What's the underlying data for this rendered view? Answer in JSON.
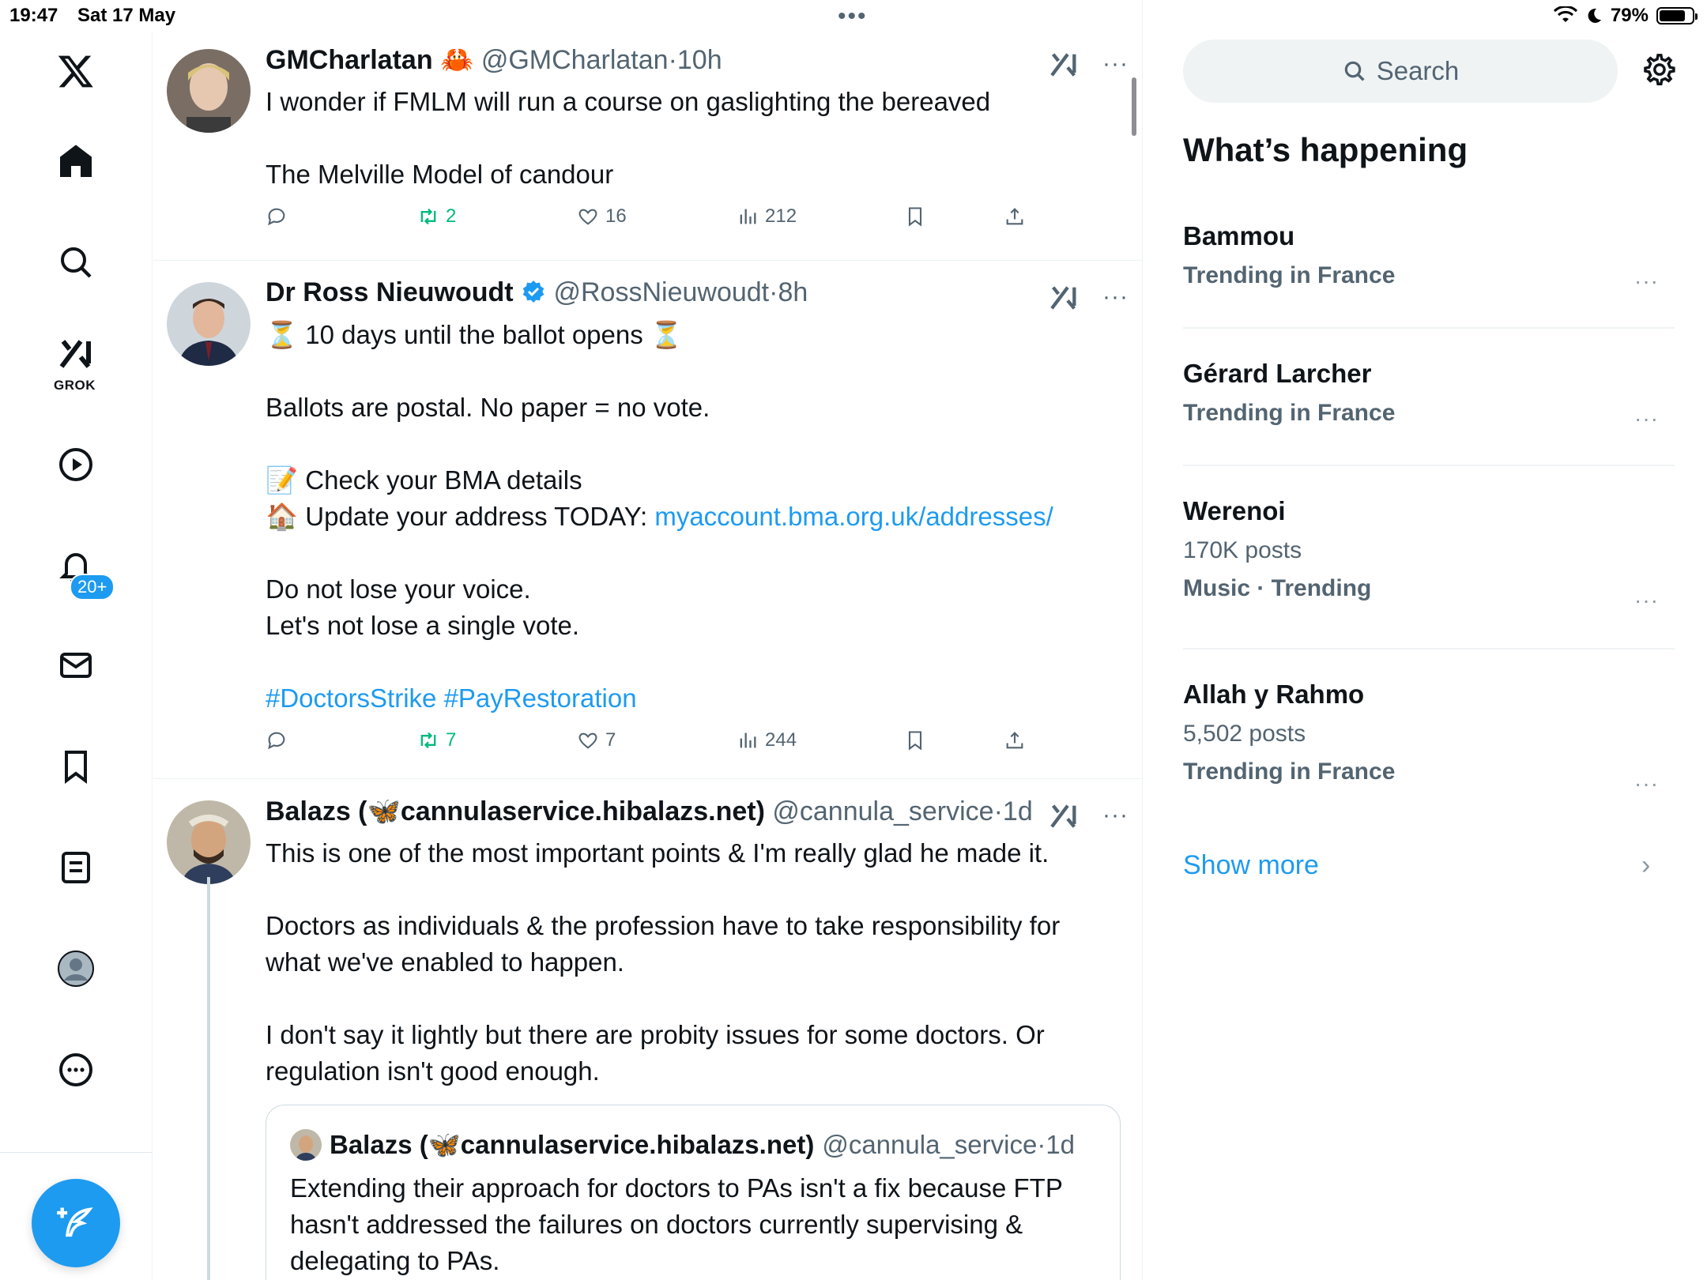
{
  "status_bar": {
    "time": "19:47",
    "date": "Sat 17 May",
    "battery": "79%",
    "battery_fraction": 0.79
  },
  "nav": {
    "grok_label": "GROK",
    "notifications_badge": "20+"
  },
  "tweets": [
    {
      "name": "GMCharlatan",
      "name_emoji": "🦀",
      "handle": "@GMCharlatan",
      "time": "10h",
      "lines": [
        "I wonder if FMLM will run a course on gaslighting the bereaved",
        "",
        "The Melville Model of candour"
      ],
      "retweets": "2",
      "likes": "16",
      "views": "212"
    },
    {
      "name": "Dr Ross Nieuwoudt",
      "handle": "@RossNieuwoudt",
      "time": "8h",
      "line1": "⏳ 10 days until the ballot opens ⏳",
      "line2": "Ballots are postal. No paper = no vote.",
      "line3": "📝 Check your BMA details",
      "line4_prefix": "🏠 Update your address TODAY: ",
      "line4_link": "myaccount.bma.org.uk/addresses/",
      "line5": "Do not lose your voice.",
      "line6": "Let's not lose a single vote.",
      "hashtags": "#DoctorsStrike #PayRestoration",
      "retweets": "7",
      "likes": "7",
      "views": "244"
    },
    {
      "name": "Balazs (🦋cannulaservice.hibalazs.net)",
      "handle": "@cannula_service",
      "time": "1d",
      "line1": "This is one of the most important points & I'm really glad he made it.",
      "line2": "Doctors as individuals & the profession have to take responsibility for what we've enabled to happen.",
      "line3": "I don't say it lightly but there are probity issues for some doctors. Or regulation isn't good enough.",
      "quote": {
        "name": "Balazs (🦋cannulaservice.hibalazs.net)",
        "handle": "@cannula_service",
        "time": "1d",
        "text": "Extending their approach for doctors to PAs isn't a fix because FTP hasn't addressed the failures on doctors currently supervising & delegating to PAs."
      }
    }
  ],
  "sidebar": {
    "search_placeholder": "Search",
    "title": "What’s happening",
    "trends": [
      {
        "name": "Bammou",
        "meta1": "Trending in France",
        "meta2": ""
      },
      {
        "name": "Gérard Larcher",
        "meta1": "Trending in France",
        "meta2": ""
      },
      {
        "name": "Werenoi",
        "meta1": "170K posts",
        "meta2": "Music · Trending"
      },
      {
        "name": "Allah y Rahmo",
        "meta1": "5,502 posts",
        "meta2": "Trending in France"
      }
    ],
    "show_more": "Show more"
  },
  "colors": {
    "accent": "#1d9bf0",
    "retweet": "#00ba7c",
    "muted": "#536471"
  }
}
